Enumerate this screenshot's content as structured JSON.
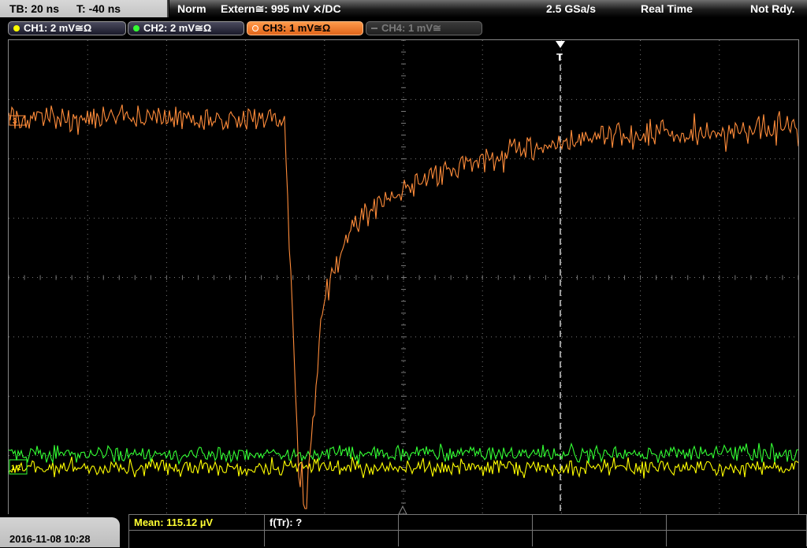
{
  "header": {
    "timebase": "TB: 20 ns",
    "trigger_time": "T: -40 ns",
    "mode": "Norm",
    "trigger_source": "Extern≅: 995 mV ⨯/DC",
    "sample_rate": "2.5 GSa/s",
    "acq_mode": "Real Time",
    "status": "Not Rdy."
  },
  "channels": [
    {
      "label": "CH1: 2 mV≅Ω",
      "color": "#ffff00",
      "active": false,
      "on": true
    },
    {
      "label": "CH2: 2 mV≅Ω",
      "color": "#33ff33",
      "active": false,
      "on": true
    },
    {
      "label": "CH3: 1 mV≅Ω",
      "color": "#ff8c3a",
      "active": true,
      "on": true
    },
    {
      "label": "CH4: 1 mV≅",
      "color": "#777777",
      "active": false,
      "on": false
    }
  ],
  "markers": {
    "ch3": "3",
    "trigger": "T",
    "ch12": "1/2"
  },
  "footer": {
    "datetime": "2016-11-08 10:28",
    "meas1": "Mean: 115.12 µV",
    "meas2": "f(Tr): ?"
  },
  "colors": {
    "ch1": "#ffff00",
    "ch2": "#33ff33",
    "ch3": "#ff8c3a",
    "grid": "#7a7a7a"
  }
}
